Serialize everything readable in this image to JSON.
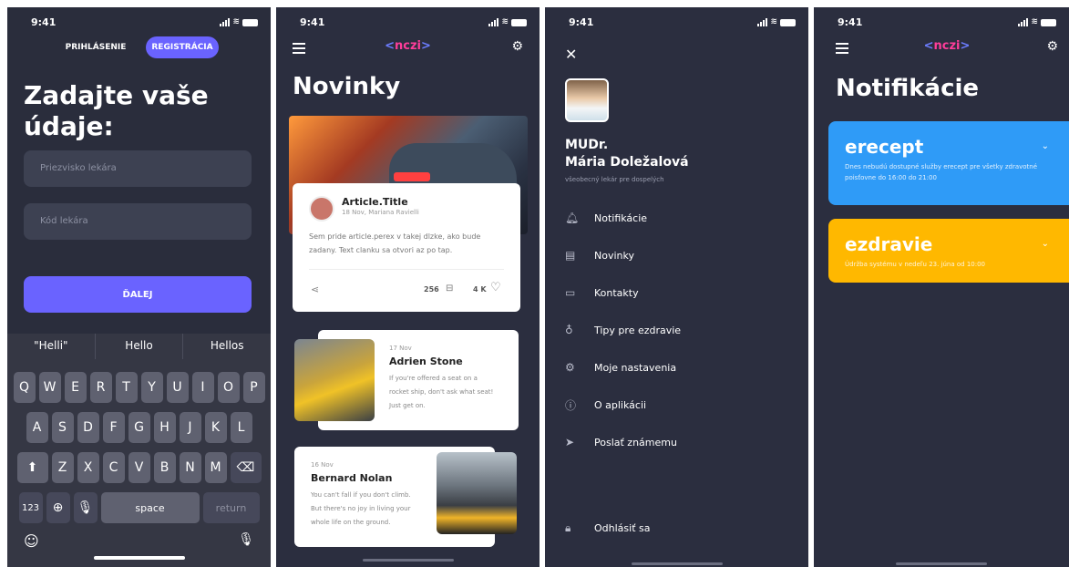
{
  "status": {
    "time": "9:41"
  },
  "s1": {
    "tab_login": "PRIHLÁSENIE",
    "tab_register": "REGISTRÁCIA",
    "title": "Zadajte vaše údaje:",
    "field1_placeholder": "Priezvisko lekára",
    "field2_placeholder": "Kód lekára",
    "next_label": "ĎALEJ",
    "suggestions": [
      "\"Helli\"",
      "Hello",
      "Hellos"
    ],
    "row1": [
      "Q",
      "W",
      "E",
      "R",
      "T",
      "Y",
      "U",
      "I",
      "O",
      "P"
    ],
    "row2": [
      "A",
      "S",
      "D",
      "F",
      "G",
      "H",
      "J",
      "K",
      "L"
    ],
    "row3": [
      "Z",
      "X",
      "C",
      "V",
      "B",
      "N",
      "M"
    ],
    "k_123": "123",
    "k_space": "space",
    "k_return": "return"
  },
  "brand": {
    "logo_lt": "<",
    "logo_text": "nczi",
    "logo_gt": ">"
  },
  "s2": {
    "title": "Novinky",
    "article": {
      "title": "Article.Title",
      "meta": "18 Nov, Mariana Ravielli",
      "perex": "Sem pride article.perex v takej dlzke, ako bude zadany. Text clanku sa otvori az po tap.",
      "comments": "256",
      "likes": "4 K"
    },
    "card1": {
      "date": "17 Nov",
      "name": "Adrien Stone",
      "text": "If you're offered a seat on a rocket ship, don't ask what seat! Just get on."
    },
    "card2": {
      "date": "16 Nov",
      "name": "Bernard Nolan",
      "text": "You can't fall if you don't climb. But there's no joy in living your whole life on the ground."
    }
  },
  "s3": {
    "name_line1": "MUDr.",
    "name_line2": "Mária Doležalová",
    "subtitle": "všeobecný lekár pre dospelých",
    "menu": [
      {
        "label": "Notifikácie",
        "icon": "bell-icon"
      },
      {
        "label": "Novinky",
        "icon": "news-icon"
      },
      {
        "label": "Kontakty",
        "icon": "contact-card-icon"
      },
      {
        "label": "Tipy pre ezdravie",
        "icon": "lightbulb-icon"
      },
      {
        "label": "Moje nastavenia",
        "icon": "gear-icon"
      },
      {
        "label": "O aplikácii",
        "icon": "info-icon"
      },
      {
        "label": "Poslať známemu",
        "icon": "send-icon"
      }
    ],
    "logout": "Odhlásiť sa"
  },
  "s4": {
    "title": "Notifikácie",
    "notifications": [
      {
        "title": "erecept",
        "text": "Dnes nebudú dostupné služby erecept pre všetky zdravotné poisťovne do 16:00 do 21:00",
        "color": "#2f9bf7"
      },
      {
        "title": "ezdravie",
        "text": "Údržba systému v nedeľu 23. júna od 10:00",
        "color": "#ffb800"
      }
    ]
  },
  "colors": {
    "bg_dark": "#2b2e3f",
    "accent": "#6a63ff",
    "logo_pink": "#ff3d9a"
  }
}
